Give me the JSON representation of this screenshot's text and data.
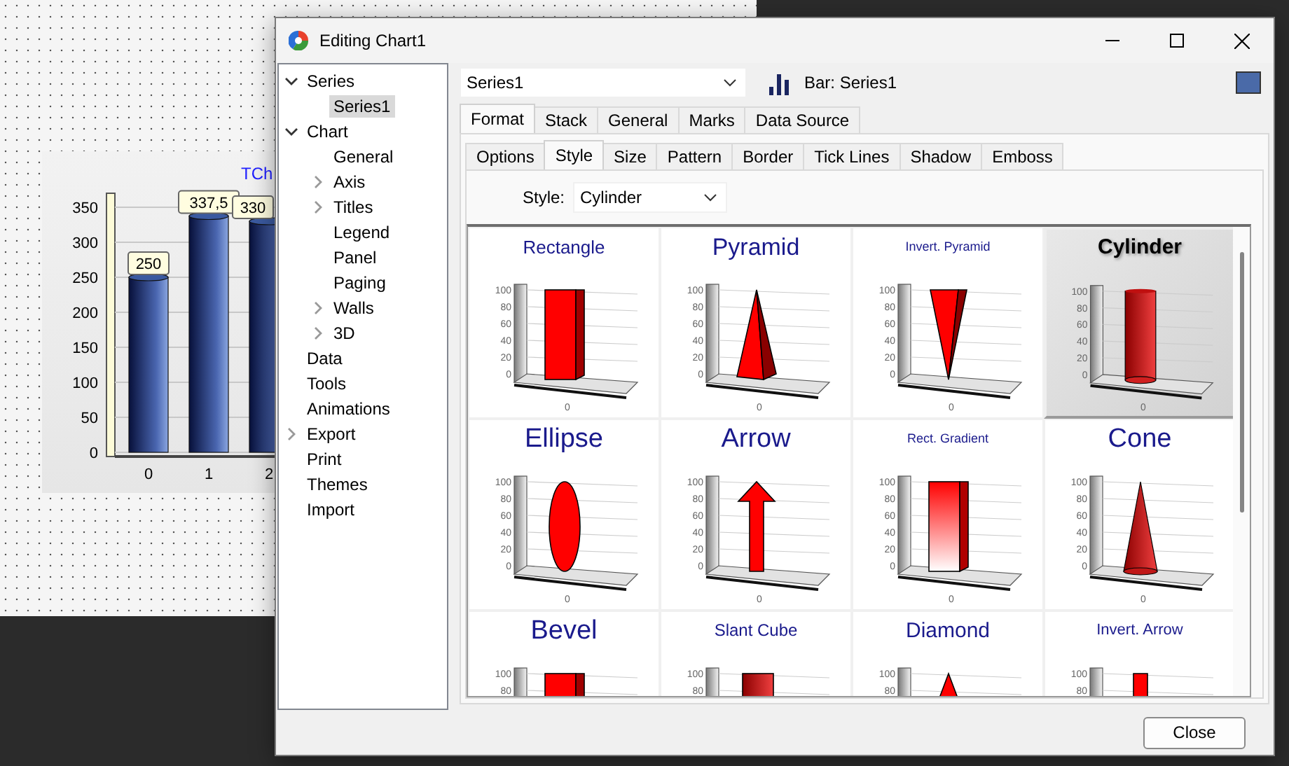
{
  "desktop": {
    "chart": {
      "chart_data": {
        "type": "bar",
        "title": "TCh",
        "categories": [
          "0",
          "1",
          "2"
        ],
        "values": [
          250,
          337.5,
          330
        ],
        "ylim": [
          0,
          370
        ],
        "grid": true,
        "yticks": [
          0,
          50,
          100,
          150,
          200,
          250,
          300,
          350
        ],
        "value_labels": [
          "250",
          "337,5",
          "330"
        ]
      }
    }
  },
  "window": {
    "title": "Editing Chart1"
  },
  "tree": [
    {
      "label": "Series",
      "expanded": true,
      "selected": false,
      "children": [
        {
          "label": "Series1",
          "selected": true
        }
      ]
    },
    {
      "label": "Chart",
      "expanded": true,
      "selected": false,
      "children": [
        {
          "label": "General",
          "selected": false
        },
        {
          "label": "Axis",
          "expanded": false,
          "selected": false
        },
        {
          "label": "Titles",
          "expanded": false,
          "selected": false
        },
        {
          "label": "Legend",
          "selected": false
        },
        {
          "label": "Panel",
          "selected": false
        },
        {
          "label": "Paging",
          "selected": false
        },
        {
          "label": "Walls",
          "expanded": false,
          "selected": false
        },
        {
          "label": "3D",
          "expanded": false,
          "selected": false
        }
      ]
    },
    {
      "label": "Data",
      "selected": false
    },
    {
      "label": "Tools",
      "selected": false
    },
    {
      "label": "Animations",
      "selected": false
    },
    {
      "label": "Export",
      "expanded": false,
      "selected": false
    },
    {
      "label": "Print",
      "selected": false
    },
    {
      "label": "Themes",
      "selected": false
    },
    {
      "label": "Import",
      "selected": false
    }
  ],
  "series_selector": {
    "value": "Series1"
  },
  "series_header": {
    "label": "Bar: Series1",
    "color": "#4a6aa8"
  },
  "tabs": [
    {
      "label": "Format",
      "selected": true
    },
    {
      "label": "Stack",
      "selected": false
    },
    {
      "label": "General",
      "selected": false
    },
    {
      "label": "Marks",
      "selected": false
    },
    {
      "label": "Data Source",
      "selected": false
    }
  ],
  "format_tabs": [
    {
      "label": "Options",
      "selected": false
    },
    {
      "label": "Style",
      "selected": true
    },
    {
      "label": "Size",
      "selected": false
    },
    {
      "label": "Pattern",
      "selected": false
    },
    {
      "label": "Border",
      "selected": false
    },
    {
      "label": "Tick Lines",
      "selected": false
    },
    {
      "label": "Shadow",
      "selected": false
    },
    {
      "label": "Emboss",
      "selected": false
    }
  ],
  "style_field": {
    "label": "Style:",
    "value": "Cylinder"
  },
  "gallery": [
    {
      "label": "Rectangle",
      "kind": "rectangle",
      "selected": false,
      "axis_labels": [
        "100",
        "80",
        "60",
        "40",
        "20",
        "0"
      ],
      "x_label": "0"
    },
    {
      "label": "Pyramid",
      "kind": "pyramid",
      "selected": false,
      "axis_labels": [
        "100",
        "80",
        "60",
        "40",
        "20",
        "0"
      ],
      "x_label": "0"
    },
    {
      "label": "Invert. Pyramid",
      "kind": "invert-pyramid",
      "selected": false,
      "axis_labels": [
        "100",
        "80",
        "60",
        "40",
        "20",
        "0"
      ],
      "x_label": "0"
    },
    {
      "label": "Cylinder",
      "kind": "cylinder",
      "selected": true,
      "axis_labels": [
        "100",
        "80",
        "60",
        "40",
        "20",
        "0"
      ],
      "x_label": "0"
    },
    {
      "label": "Ellipse",
      "kind": "ellipse",
      "selected": false,
      "axis_labels": [
        "100",
        "80",
        "60",
        "40",
        "20",
        "0"
      ],
      "x_label": "0"
    },
    {
      "label": "Arrow",
      "kind": "arrow",
      "selected": false,
      "axis_labels": [
        "100",
        "80",
        "60",
        "40",
        "20",
        "0"
      ],
      "x_label": "0"
    },
    {
      "label": "Rect. Gradient",
      "kind": "rect-gradient",
      "selected": false,
      "axis_labels": [
        "100",
        "80",
        "60",
        "40",
        "20",
        "0"
      ],
      "x_label": "0"
    },
    {
      "label": "Cone",
      "kind": "cone",
      "selected": false,
      "axis_labels": [
        "100",
        "80",
        "60",
        "40",
        "20",
        "0"
      ],
      "x_label": "0"
    },
    {
      "label": "Bevel",
      "kind": "bevel",
      "selected": false,
      "axis_labels": [
        "100",
        "80"
      ]
    },
    {
      "label": "Slant Cube",
      "kind": "slant-cube",
      "selected": false,
      "axis_labels": [
        "100",
        "80"
      ]
    },
    {
      "label": "Diamond",
      "kind": "diamond",
      "selected": false,
      "axis_labels": [
        "100",
        "80"
      ]
    },
    {
      "label": "Invert. Arrow",
      "kind": "invert-arrow",
      "selected": false,
      "axis_labels": [
        "100",
        "80"
      ]
    }
  ],
  "buttons": [
    {
      "label": "Close"
    }
  ]
}
